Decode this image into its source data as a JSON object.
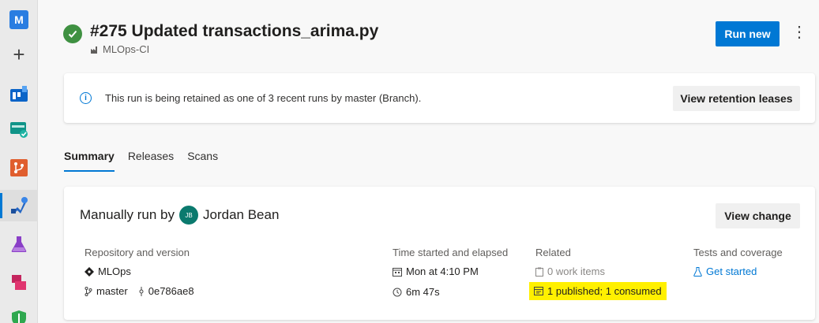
{
  "nav": {
    "org_initial": "M",
    "items": [
      {
        "name": "org",
        "icon": "org-badge"
      },
      {
        "name": "new",
        "icon": "plus-icon"
      },
      {
        "name": "boards",
        "icon": "boards-icon"
      },
      {
        "name": "test-plans-top",
        "icon": "tasks-icon"
      },
      {
        "name": "repos",
        "icon": "repos-icon"
      },
      {
        "name": "pipelines",
        "icon": "pipelines-icon"
      },
      {
        "name": "test-plans",
        "icon": "flask-icon"
      },
      {
        "name": "artifacts",
        "icon": "artifacts-icon"
      },
      {
        "name": "security",
        "icon": "shield-icon"
      }
    ]
  },
  "header": {
    "title": "#275 Updated transactions_arima.py",
    "pipeline": "MLOps-CI",
    "run_new": "Run new",
    "more": "⋮"
  },
  "banner": {
    "text": "This run is being retained as one of 3 recent runs by master (Branch).",
    "button": "View retention leases"
  },
  "tabs": [
    {
      "label": "Summary"
    },
    {
      "label": "Releases"
    },
    {
      "label": "Scans"
    }
  ],
  "summary": {
    "manually_run_by": "Manually run by",
    "avatar_initials": "JB",
    "user": "Jordan Bean",
    "view_change": "View change",
    "repository": {
      "heading": "Repository and version",
      "repo": "MLOps",
      "branch": "master",
      "commit": "0e786ae8"
    },
    "time": {
      "heading": "Time started and elapsed",
      "started": "Mon at 4:10 PM",
      "elapsed": "6m 47s"
    },
    "related": {
      "heading": "Related",
      "work_items": "0 work items",
      "artifacts": "1 published; 1 consumed"
    },
    "tests": {
      "heading": "Tests and coverage",
      "link": "Get started"
    }
  },
  "colors": {
    "accent": "#0078d4",
    "success": "#3f9142",
    "highlight": "#fff000"
  }
}
